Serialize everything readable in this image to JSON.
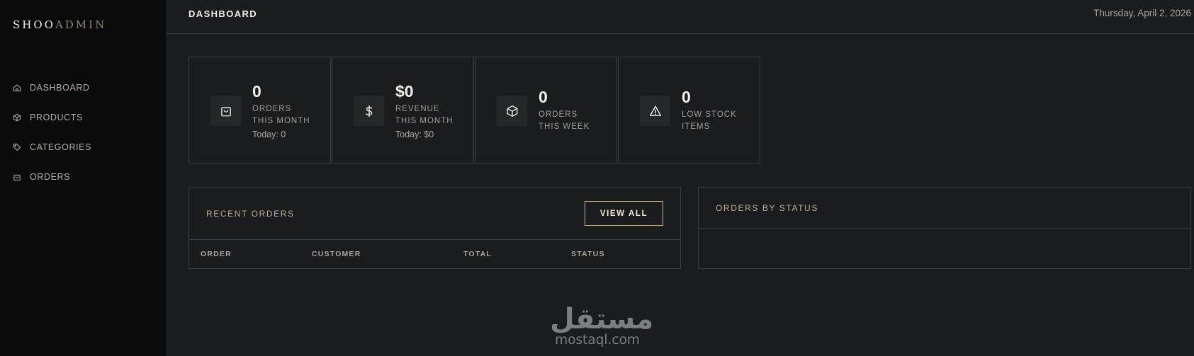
{
  "brand": {
    "part1": "SHOO",
    "part2": "ADMIN"
  },
  "sidebar": {
    "items": [
      {
        "label": "DASHBOARD",
        "icon": "home-icon"
      },
      {
        "label": "PRODUCTS",
        "icon": "box-icon"
      },
      {
        "label": "CATEGORIES",
        "icon": "tag-icon"
      },
      {
        "label": "ORDERS",
        "icon": "shopping-bag-icon"
      }
    ]
  },
  "header": {
    "title": "DASHBOARD",
    "date": "Thursday, April 2, 2026"
  },
  "stats": [
    {
      "value": "0",
      "label_line1": "ORDERS",
      "label_line2": "THIS MONTH",
      "today": "Today: 0",
      "icon": "shopping-bag-icon"
    },
    {
      "value": "$0",
      "label_line1": "REVENUE",
      "label_line2": "THIS MONTH",
      "today": "Today: $0",
      "icon": "dollar-icon"
    },
    {
      "value": "0",
      "label_line1": "ORDERS",
      "label_line2": "THIS WEEK",
      "icon": "box-icon"
    },
    {
      "value": "0",
      "label_line1": "LOW STOCK",
      "label_line2": "ITEMS",
      "icon": "warning-icon"
    }
  ],
  "recent_orders": {
    "title": "RECENT ORDERS",
    "view_all_label": "VIEW ALL",
    "columns": [
      "ORDER",
      "CUSTOMER",
      "TOTAL",
      "STATUS"
    ]
  },
  "orders_by_status": {
    "title": "ORDERS BY STATUS"
  },
  "watermark": {
    "arabic": "مستقل",
    "latin": "mostaql.com"
  },
  "colors": {
    "background": "#1b1c1e",
    "sidebar": "#0a0a0a",
    "border": "#3d3e40",
    "accent_gold": "#c8b894",
    "logo_secondary": "#8c8576"
  }
}
